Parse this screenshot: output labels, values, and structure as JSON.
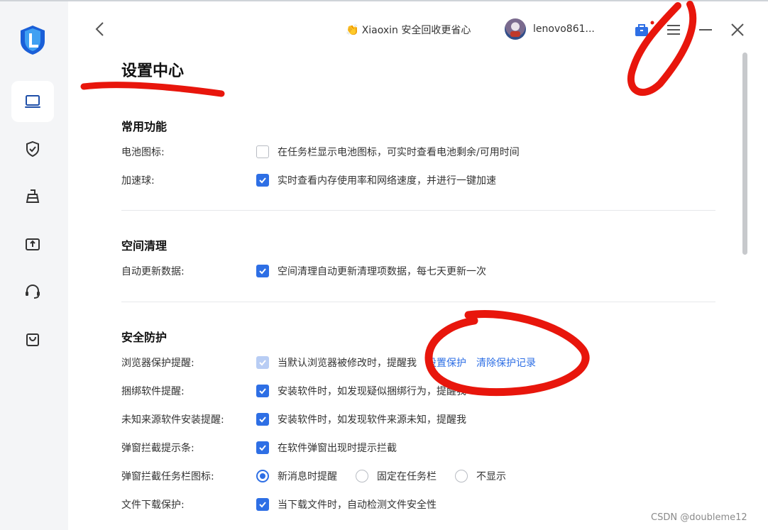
{
  "header": {
    "promo_icon": "👏",
    "promo_text": "Xiaoxin 安全回收更省心",
    "username": "lenovo861...",
    "icons": [
      "back-arrow-icon",
      "bag-icon",
      "menu-icon",
      "minimize-icon",
      "close-icon"
    ]
  },
  "sidebar": {
    "items": [
      {
        "icon": "laptop-icon",
        "active": true
      },
      {
        "icon": "shield-check-icon",
        "active": false
      },
      {
        "icon": "broom-icon",
        "active": false
      },
      {
        "icon": "drive-upload-icon",
        "active": false
      },
      {
        "icon": "headset-icon",
        "active": false
      },
      {
        "icon": "shopping-bag-icon",
        "active": false
      }
    ]
  },
  "page": {
    "title": "设置中心",
    "sections": {
      "common": {
        "title": "常用功能",
        "battery_label": "电池图标:",
        "battery_text": "在任务栏显示电池图标，可实时查看电池剩余/可用时间",
        "battery_checked": false,
        "ball_label": "加速球:",
        "ball_text": "实时查看内存使用率和网络速度，并进行一键加速",
        "ball_checked": true
      },
      "cleanup": {
        "title": "空间清理",
        "auto_label": "自动更新数据:",
        "auto_text": "空间清理自动更新清理项数据，每七天更新一次",
        "auto_checked": true
      },
      "security": {
        "title": "安全防护",
        "browser_label": "浏览器保护提醒:",
        "browser_text": "当默认浏览器被修改时，提醒我",
        "browser_link1": "设置保护",
        "browser_link2": "清除保护记录",
        "bundle_label": "捆绑软件提醒:",
        "bundle_text": "安装软件时，如发现疑似捆绑行为，提醒我",
        "unknown_label": "未知来源软件安装提醒:",
        "unknown_text": "安装软件时，如发现软件来源未知，提醒我",
        "popup_label": "弹窗拦截提示条:",
        "popup_text": "在软件弹窗出现时提示拦截",
        "tray_label": "弹窗拦截任务栏图标:",
        "tray_options": [
          "新消息时提醒",
          "固定在任务栏",
          "不显示"
        ],
        "tray_selected": "新消息时提醒",
        "download_label": "文件下载保护:",
        "download_text": "当下载文件时，自动检测文件安全性"
      }
    }
  },
  "watermark": "CSDN @doubleme12",
  "colors": {
    "accent": "#2e6fe5",
    "annotation": "#e8160c"
  }
}
